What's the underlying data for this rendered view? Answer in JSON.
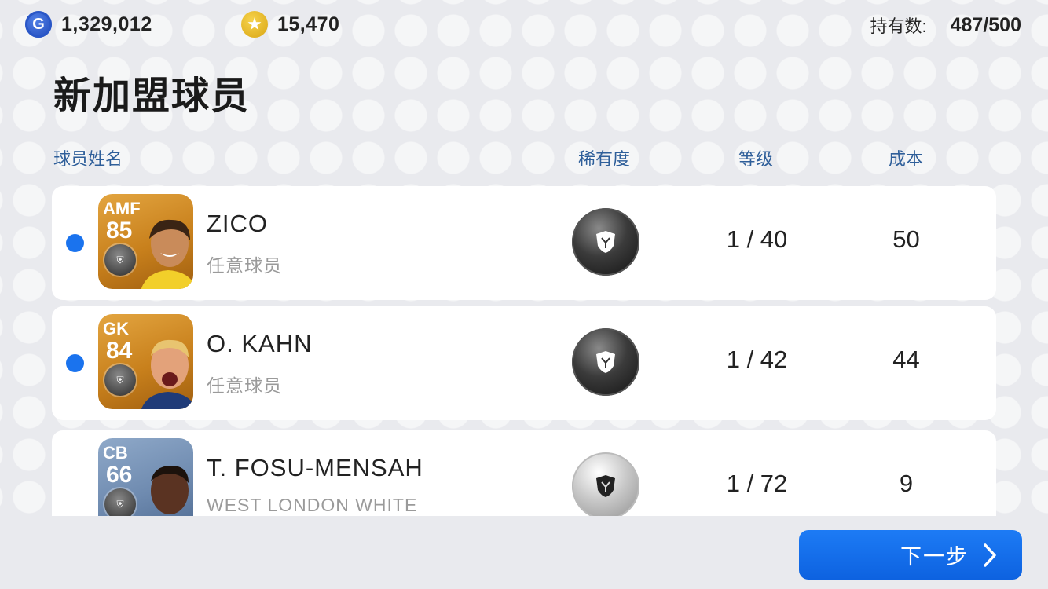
{
  "topbar": {
    "gp_icon": "G",
    "gp_value": "1,329,012",
    "coin_icon": "star-icon",
    "coin_value": "15,470",
    "holding_label": "持有数:",
    "holding_value": "487/500"
  },
  "page": {
    "title": "新加盟球员"
  },
  "columns": {
    "name": "球员姓名",
    "rarity": "稀有度",
    "level": "等级",
    "cost": "成本"
  },
  "players": [
    {
      "position": "AMF",
      "rating": "85",
      "name": "ZICO",
      "subtitle": "任意球员",
      "rarity": "black-ball",
      "level": "1 / 40",
      "cost": "50",
      "new": true,
      "card_color": "#d8922a"
    },
    {
      "position": "GK",
      "rating": "84",
      "name": "O. KAHN",
      "subtitle": "任意球员",
      "rarity": "black-ball",
      "level": "1 / 42",
      "cost": "44",
      "new": true,
      "card_color": "#d8922a"
    },
    {
      "position": "CB",
      "rating": "66",
      "name": "T. FOSU-MENSAH",
      "subtitle": "WEST LONDON WHITE",
      "rarity": "silver-ball",
      "level": "1 / 72",
      "cost": "9",
      "new": false,
      "card_color": "#7d96ba"
    }
  ],
  "footer": {
    "next_label": "下一步"
  },
  "colors": {
    "accent": "#1a73ee",
    "header_text": "#2f5f9a",
    "background": "#e9eaee"
  }
}
